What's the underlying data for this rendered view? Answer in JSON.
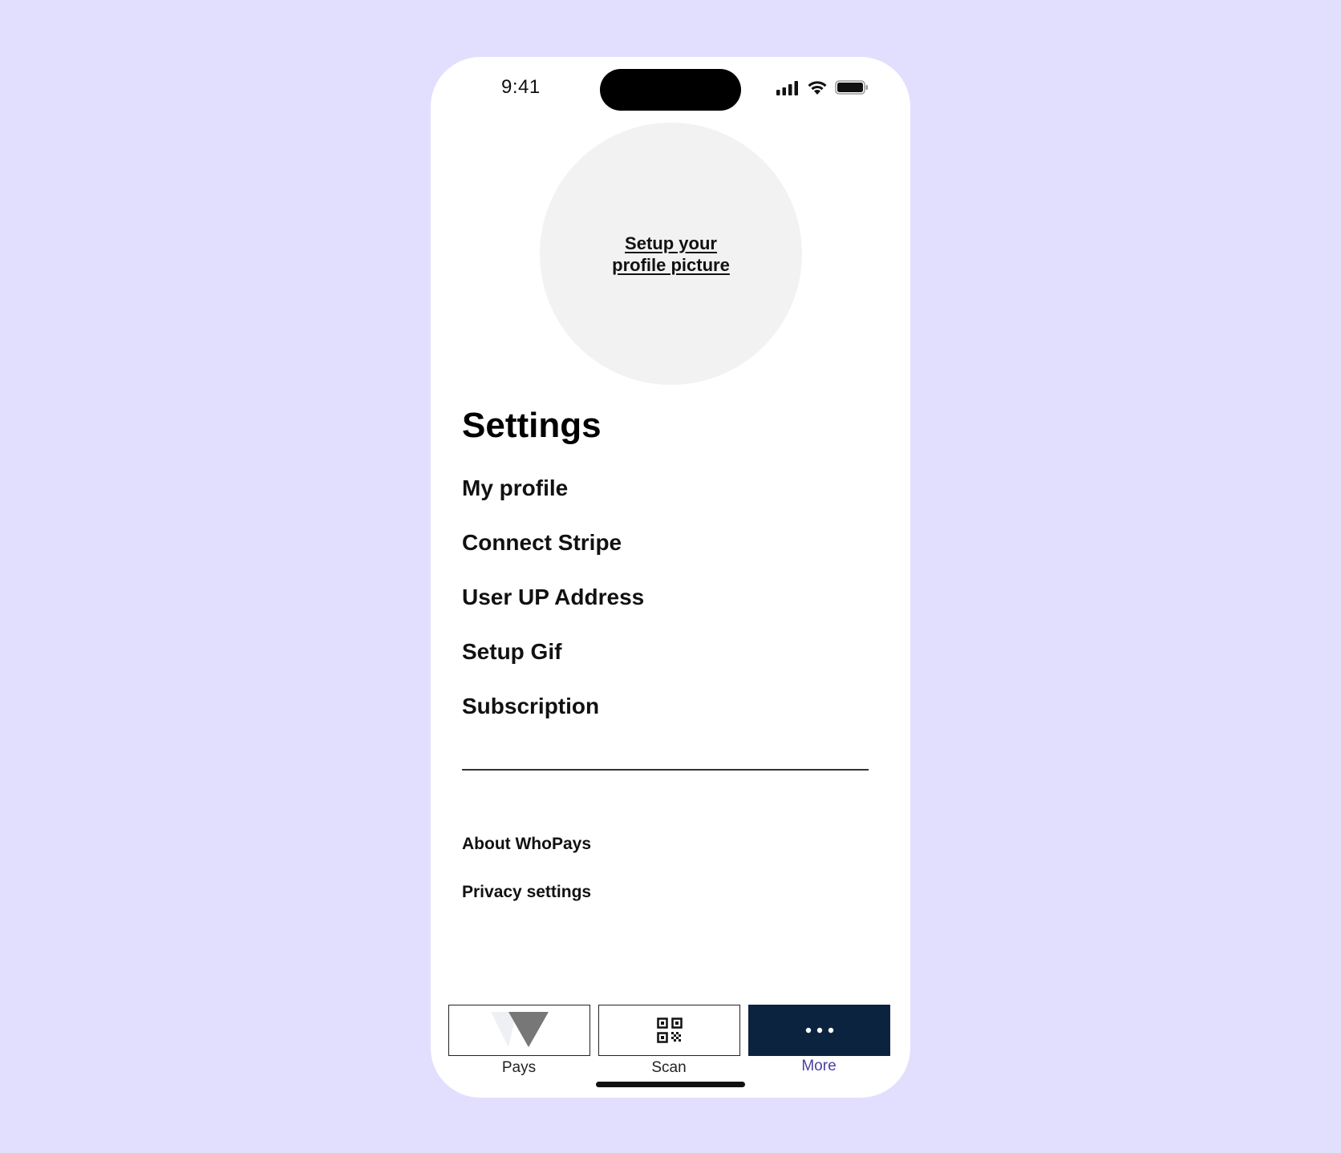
{
  "status_bar": {
    "time": "9:41",
    "icons": [
      "signal-icon",
      "wifi-icon",
      "battery-icon"
    ]
  },
  "profile": {
    "avatar_link_label": "Setup your profile picture"
  },
  "settings": {
    "title": "Settings",
    "items": [
      {
        "label": "My profile"
      },
      {
        "label": "Connect Stripe"
      },
      {
        "label": "User UP Address"
      },
      {
        "label": "Setup Gif"
      },
      {
        "label": "Subscription"
      }
    ],
    "secondary_items": [
      {
        "label": "About WhoPays"
      },
      {
        "label": "Privacy settings"
      }
    ]
  },
  "tab_bar": {
    "tabs": [
      {
        "label": "Pays",
        "icon": "whopays-logo-icon",
        "active": false
      },
      {
        "label": "Scan",
        "icon": "qr-code-icon",
        "active": false
      },
      {
        "label": "More",
        "icon": "more-dots-icon",
        "active": true
      }
    ]
  },
  "colors": {
    "background": "#e2dffe",
    "active_tab": "#0c2340",
    "active_tab_label": "#4b3fa0",
    "avatar_fill": "#f2f2f2"
  }
}
